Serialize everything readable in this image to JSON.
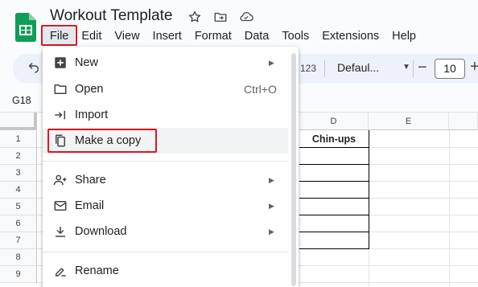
{
  "app": {
    "title": "Workout Template",
    "icons": [
      "star-icon",
      "move-to-folder-icon",
      "cloud-status-icon"
    ]
  },
  "menubar": [
    "File",
    "Edit",
    "View",
    "Insert",
    "Format",
    "Data",
    "Tools",
    "Extensions",
    "Help"
  ],
  "toolbar": {
    "undo_icon": "undo-icon",
    "number_format": "123",
    "font": "Defaul...",
    "font_size": "10",
    "minus": "−",
    "plus": "+"
  },
  "namebox": "G18",
  "grid": {
    "columns": [
      "D",
      "E"
    ],
    "rows": [
      "1",
      "2",
      "3",
      "4",
      "5",
      "6",
      "7",
      "8",
      "9"
    ],
    "d1": "Chin-ups"
  },
  "file_menu": {
    "items": [
      {
        "label": "New",
        "icon": "new-sheet-icon",
        "submenu": true
      },
      {
        "label": "Open",
        "icon": "folder-icon",
        "shortcut": "Ctrl+O"
      },
      {
        "label": "Import",
        "icon": "import-icon"
      },
      {
        "label": "Make a copy",
        "icon": "copy-icon"
      },
      {
        "label": "Share",
        "icon": "share-person-icon",
        "submenu": true
      },
      {
        "label": "Email",
        "icon": "email-icon",
        "submenu": true
      },
      {
        "label": "Download",
        "icon": "download-icon",
        "submenu": true
      },
      {
        "label": "Rename",
        "icon": "rename-icon"
      }
    ]
  },
  "colors": {
    "highlight": "#e0161e",
    "sheets_green": "#0f9d58"
  }
}
